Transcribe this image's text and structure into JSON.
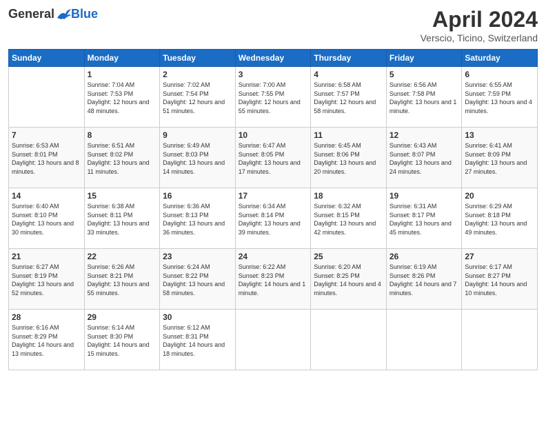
{
  "header": {
    "logo_general": "General",
    "logo_blue": "Blue",
    "month_title": "April 2024",
    "location": "Verscio, Ticino, Switzerland"
  },
  "days_of_week": [
    "Sunday",
    "Monday",
    "Tuesday",
    "Wednesday",
    "Thursday",
    "Friday",
    "Saturday"
  ],
  "weeks": [
    [
      {
        "day": "",
        "info": ""
      },
      {
        "day": "1",
        "info": "Sunrise: 7:04 AM\nSunset: 7:53 PM\nDaylight: 12 hours\nand 48 minutes."
      },
      {
        "day": "2",
        "info": "Sunrise: 7:02 AM\nSunset: 7:54 PM\nDaylight: 12 hours\nand 51 minutes."
      },
      {
        "day": "3",
        "info": "Sunrise: 7:00 AM\nSunset: 7:55 PM\nDaylight: 12 hours\nand 55 minutes."
      },
      {
        "day": "4",
        "info": "Sunrise: 6:58 AM\nSunset: 7:57 PM\nDaylight: 12 hours\nand 58 minutes."
      },
      {
        "day": "5",
        "info": "Sunrise: 6:56 AM\nSunset: 7:58 PM\nDaylight: 13 hours\nand 1 minute."
      },
      {
        "day": "6",
        "info": "Sunrise: 6:55 AM\nSunset: 7:59 PM\nDaylight: 13 hours\nand 4 minutes."
      }
    ],
    [
      {
        "day": "7",
        "info": "Sunrise: 6:53 AM\nSunset: 8:01 PM\nDaylight: 13 hours\nand 8 minutes."
      },
      {
        "day": "8",
        "info": "Sunrise: 6:51 AM\nSunset: 8:02 PM\nDaylight: 13 hours\nand 11 minutes."
      },
      {
        "day": "9",
        "info": "Sunrise: 6:49 AM\nSunset: 8:03 PM\nDaylight: 13 hours\nand 14 minutes."
      },
      {
        "day": "10",
        "info": "Sunrise: 6:47 AM\nSunset: 8:05 PM\nDaylight: 13 hours\nand 17 minutes."
      },
      {
        "day": "11",
        "info": "Sunrise: 6:45 AM\nSunset: 8:06 PM\nDaylight: 13 hours\nand 20 minutes."
      },
      {
        "day": "12",
        "info": "Sunrise: 6:43 AM\nSunset: 8:07 PM\nDaylight: 13 hours\nand 24 minutes."
      },
      {
        "day": "13",
        "info": "Sunrise: 6:41 AM\nSunset: 8:09 PM\nDaylight: 13 hours\nand 27 minutes."
      }
    ],
    [
      {
        "day": "14",
        "info": "Sunrise: 6:40 AM\nSunset: 8:10 PM\nDaylight: 13 hours\nand 30 minutes."
      },
      {
        "day": "15",
        "info": "Sunrise: 6:38 AM\nSunset: 8:11 PM\nDaylight: 13 hours\nand 33 minutes."
      },
      {
        "day": "16",
        "info": "Sunrise: 6:36 AM\nSunset: 8:13 PM\nDaylight: 13 hours\nand 36 minutes."
      },
      {
        "day": "17",
        "info": "Sunrise: 6:34 AM\nSunset: 8:14 PM\nDaylight: 13 hours\nand 39 minutes."
      },
      {
        "day": "18",
        "info": "Sunrise: 6:32 AM\nSunset: 8:15 PM\nDaylight: 13 hours\nand 42 minutes."
      },
      {
        "day": "19",
        "info": "Sunrise: 6:31 AM\nSunset: 8:17 PM\nDaylight: 13 hours\nand 45 minutes."
      },
      {
        "day": "20",
        "info": "Sunrise: 6:29 AM\nSunset: 8:18 PM\nDaylight: 13 hours\nand 49 minutes."
      }
    ],
    [
      {
        "day": "21",
        "info": "Sunrise: 6:27 AM\nSunset: 8:19 PM\nDaylight: 13 hours\nand 52 minutes."
      },
      {
        "day": "22",
        "info": "Sunrise: 6:26 AM\nSunset: 8:21 PM\nDaylight: 13 hours\nand 55 minutes."
      },
      {
        "day": "23",
        "info": "Sunrise: 6:24 AM\nSunset: 8:22 PM\nDaylight: 13 hours\nand 58 minutes."
      },
      {
        "day": "24",
        "info": "Sunrise: 6:22 AM\nSunset: 8:23 PM\nDaylight: 14 hours\nand 1 minute."
      },
      {
        "day": "25",
        "info": "Sunrise: 6:20 AM\nSunset: 8:25 PM\nDaylight: 14 hours\nand 4 minutes."
      },
      {
        "day": "26",
        "info": "Sunrise: 6:19 AM\nSunset: 8:26 PM\nDaylight: 14 hours\nand 7 minutes."
      },
      {
        "day": "27",
        "info": "Sunrise: 6:17 AM\nSunset: 8:27 PM\nDaylight: 14 hours\nand 10 minutes."
      }
    ],
    [
      {
        "day": "28",
        "info": "Sunrise: 6:16 AM\nSunset: 8:29 PM\nDaylight: 14 hours\nand 13 minutes."
      },
      {
        "day": "29",
        "info": "Sunrise: 6:14 AM\nSunset: 8:30 PM\nDaylight: 14 hours\nand 15 minutes."
      },
      {
        "day": "30",
        "info": "Sunrise: 6:12 AM\nSunset: 8:31 PM\nDaylight: 14 hours\nand 18 minutes."
      },
      {
        "day": "",
        "info": ""
      },
      {
        "day": "",
        "info": ""
      },
      {
        "day": "",
        "info": ""
      },
      {
        "day": "",
        "info": ""
      }
    ]
  ]
}
